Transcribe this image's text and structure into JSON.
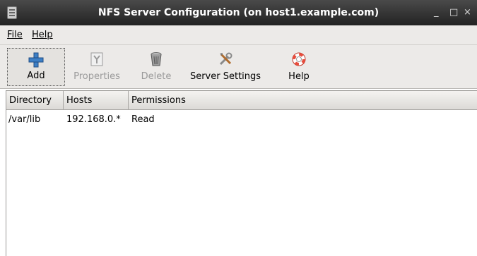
{
  "window": {
    "title": "NFS Server Configuration (on host1.example.com)",
    "minimize": "_",
    "maximize": "□",
    "close": "×"
  },
  "menu": {
    "file": "File",
    "help": "Help"
  },
  "toolbar": {
    "add": "Add",
    "properties": "Properties",
    "delete": "Delete",
    "server_settings": "Server Settings",
    "help": "Help"
  },
  "table": {
    "columns": [
      "Directory",
      "Hosts",
      "Permissions"
    ],
    "rows": [
      [
        "/var/lib",
        "192.168.0.*",
        "Read"
      ]
    ]
  },
  "icons": {
    "app": "app-document-icon",
    "add": "plus-icon",
    "properties": "properties-icon",
    "delete": "trash-can-icon",
    "server_settings": "tools-icon",
    "help": "lifebuoy-icon"
  }
}
